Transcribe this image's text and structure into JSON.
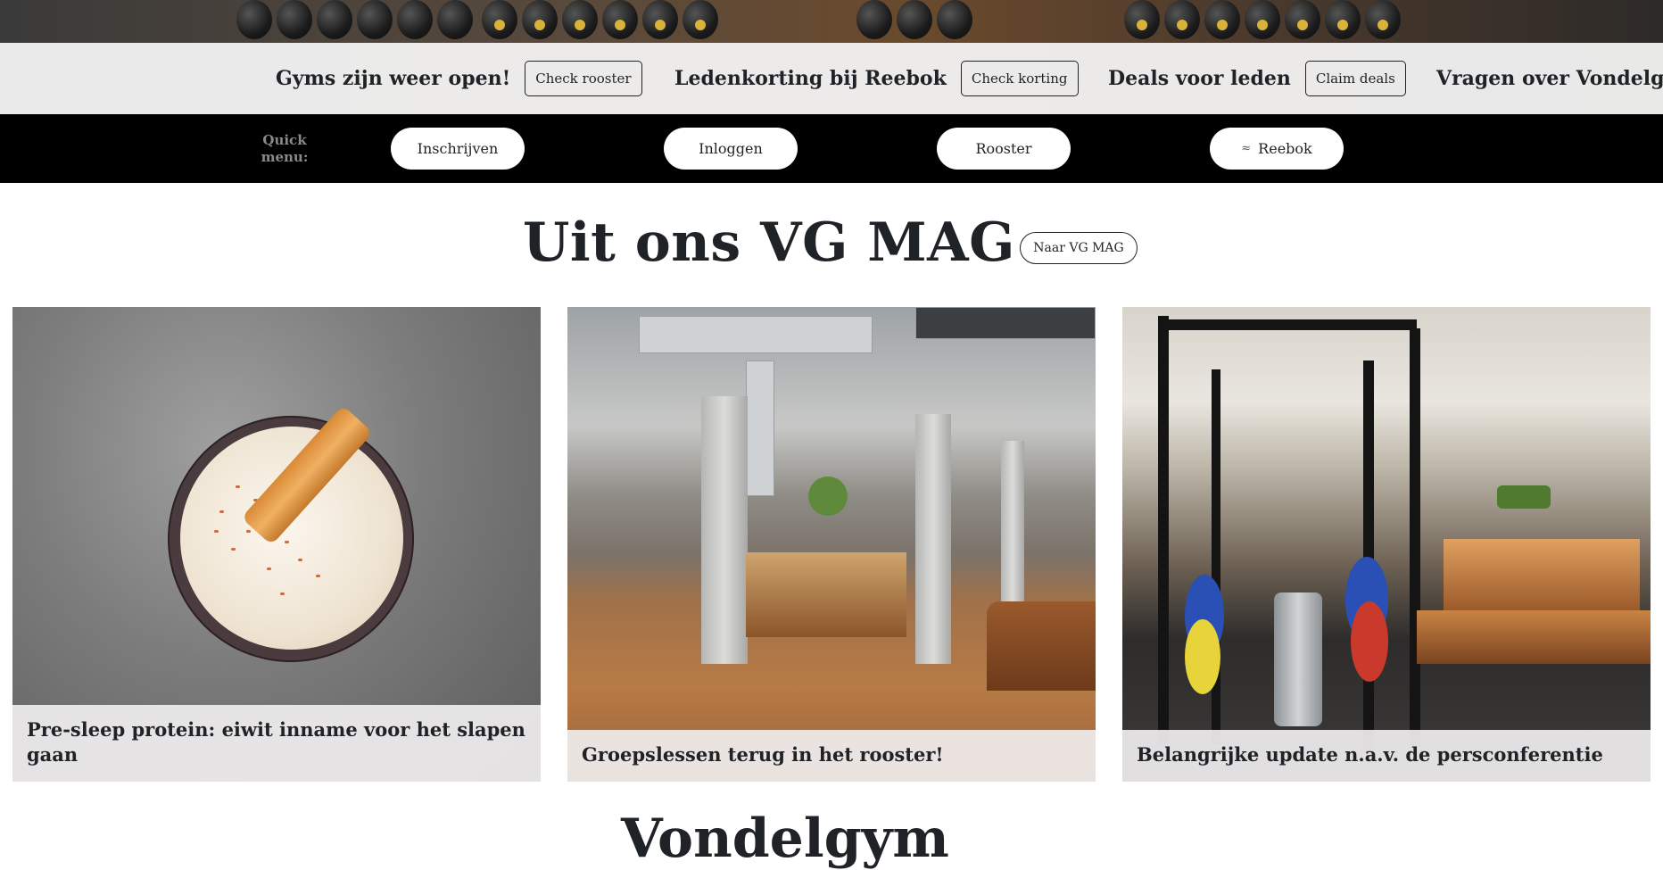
{
  "ticker": [
    {
      "title": "Gyms zijn weer open!",
      "button": "Check rooster"
    },
    {
      "title": "Ledenkorting bij Reebok",
      "button": "Check korting"
    },
    {
      "title": "Deals voor leden",
      "button": "Claim deals"
    },
    {
      "title": "Vragen over Vondelg",
      "button": ""
    }
  ],
  "quick_menu": {
    "label": "Quick menu:",
    "buttons": [
      "Inschrijven",
      "Inloggen",
      "Rooster",
      "Reebok"
    ]
  },
  "mag": {
    "title": "Uit ons VG MAG",
    "button": "Naar VG MAG",
    "cards": [
      {
        "caption": "Pre-sleep protein: eiwit inname voor het slapen gaan"
      },
      {
        "caption": "Groepslessen terug in het rooster!"
      },
      {
        "caption": "Belangrijke update n.a.v. de persconferentie"
      }
    ]
  },
  "next_heading": "Vondelgym"
}
